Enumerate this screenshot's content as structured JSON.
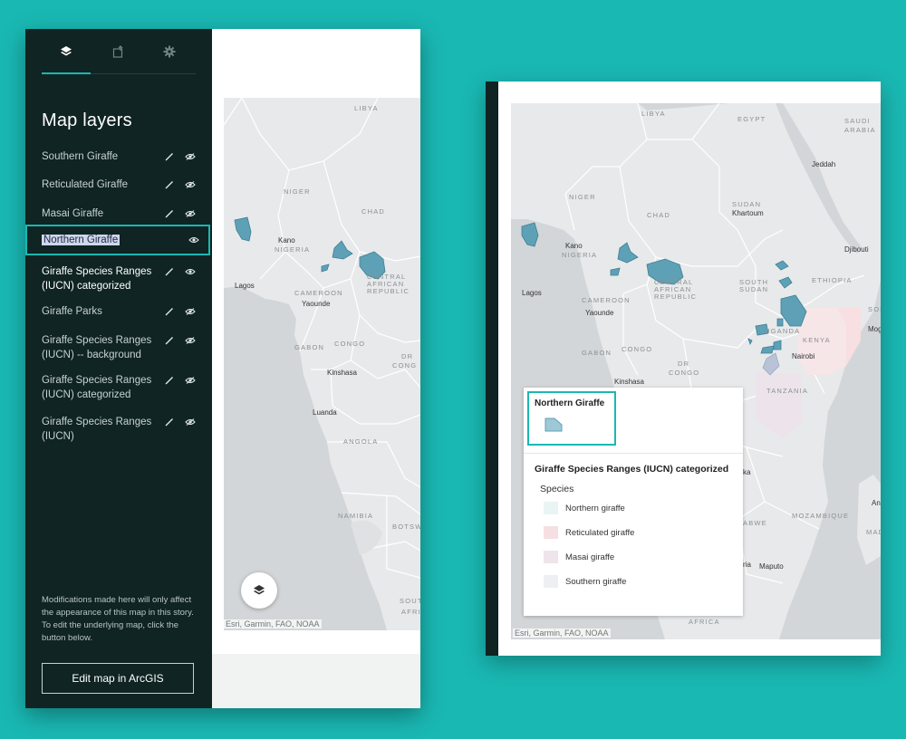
{
  "panel": {
    "tabs": [
      {
        "icon": "layers-icon",
        "active": true
      },
      {
        "icon": "legend-icon",
        "active": false
      },
      {
        "icon": "gear-icon",
        "active": false
      }
    ],
    "title": "Map layers",
    "layers": [
      {
        "label": "Southern Giraffe"
      },
      {
        "label": "Reticulated Giraffe"
      },
      {
        "label": "Masai Giraffe"
      },
      {
        "label": "Northern Giraffe"
      },
      {
        "label": "Giraffe Species Ranges (IUCN) categorized"
      },
      {
        "label": "Giraffe Parks"
      },
      {
        "label": "Giraffe Species Ranges (IUCN) -- background"
      },
      {
        "label": "Giraffe Species Ranges (IUCN) categorized"
      },
      {
        "label": "Giraffe Species Ranges (IUCN)"
      }
    ],
    "note": "Modifications made here will only affect the appearance of this map in this story. To edit the underlying map, click the button below.",
    "edit_button": "Edit map in ArcGIS"
  },
  "map_left": {
    "labels": {
      "libya": "LIBYA",
      "niger": "NIGER",
      "chad": "CHAD",
      "kano": "Kano",
      "nigeria": "NIGERIA",
      "car1": "CENTRAL",
      "car2": "AFRICAN",
      "car3": "REPUBLIC",
      "lagos": "Lagos",
      "cameroon": "CAMEROON",
      "yaounde": "Yaounde",
      "gabon": "GABON",
      "congo": "CONGO",
      "dr": "DR",
      "drcongo": "CONG",
      "kinshasa": "Kinshasa",
      "luanda": "Luanda",
      "angola": "ANGOLA",
      "namibia": "NAMIBIA",
      "botsw": "BOTSW",
      "sou": "SOUT",
      "afri": "AFRI"
    },
    "attribution": "Esri, Garmin, FAO, NOAA"
  },
  "map_right": {
    "labels": {
      "libya": "LIBYA",
      "egypt": "EGYPT",
      "saudi": "SAUDI",
      "arabia": "ARABIA",
      "jeddah": "Jeddah",
      "niger": "NIGER",
      "chad": "CHAD",
      "sudan": "SUDAN",
      "khartoum": "Khartoum",
      "kano": "Kano",
      "nigeria": "NIGERIA",
      "djibouti": "Djibouti",
      "lagos": "Lagos",
      "car1": "CENTRAL",
      "car2": "AFRICAN",
      "car3": "REPUBLIC",
      "ssudan1": "SOUTH",
      "ssudan2": "SUDAN",
      "ethiopia": "ETHIOPIA",
      "som": "SOM",
      "cameroon": "CAMEROON",
      "yaounde": "Yaounde",
      "mogad": "Mogad",
      "uganda": "UGANDA",
      "kenya": "KENYA",
      "gabon": "GABON",
      "congo": "CONGO",
      "dr": "DR",
      "drcongo": "CONGO",
      "nairobi": "Nairobi",
      "kinshasa": "Kinshasa",
      "tanzania": "TANZANIA",
      "ka": "ka",
      "mozambique": "MOZAMBIQUE",
      "abwe": "ABWE",
      "an": "An",
      "mada": "MADA",
      "ria": "ria",
      "maputo": "Maputo",
      "africa": "AFRICA"
    },
    "attribution": "Esri, Garmin, FAO, NOAA"
  },
  "legend": {
    "highlight_title": "Northern Giraffe",
    "title": "Giraffe Species Ranges (IUCN) categorized",
    "subtitle": "Species",
    "items": [
      {
        "label": "Northern giraffe",
        "color": "#e9f4f4"
      },
      {
        "label": "Reticulated giraffe",
        "color": "#f6dfe2"
      },
      {
        "label": "Masai giraffe",
        "color": "#efe4ea"
      },
      {
        "label": "Southern giraffe",
        "color": "#eeeff2"
      }
    ]
  },
  "colors": {
    "accent": "#1ab8b3",
    "panel": "#0f2423",
    "range_fill": "#5ea1b7"
  }
}
